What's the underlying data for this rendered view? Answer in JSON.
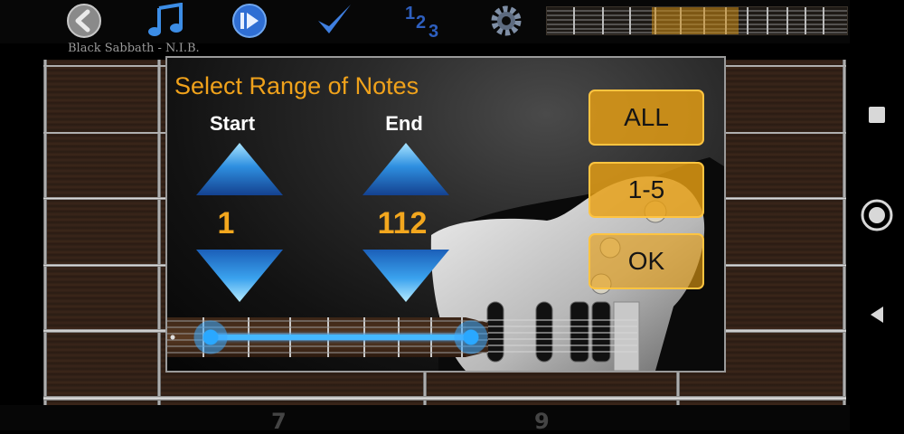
{
  "song": {
    "title": "Black Sabbath - N.I.B."
  },
  "toolbar": {
    "icons": [
      "back-arrow-icon",
      "music-note-icon",
      "play-icon",
      "checkmark-icon",
      "numbers-123-icon",
      "gear-icon"
    ]
  },
  "fretboard": {
    "visible_fret_numbers": [
      "7",
      "9"
    ]
  },
  "dialog": {
    "title": "Select Range of Notes",
    "start": {
      "label": "Start",
      "value": "1"
    },
    "end": {
      "label": "End",
      "value": "112"
    },
    "buttons": {
      "all": "ALL",
      "one_to_five": "1-5",
      "ok": "OK"
    },
    "range_selection": {
      "start_fraction": 0.0,
      "end_fraction": 1.0
    }
  },
  "colors": {
    "accent_orange": "#f0a21b",
    "arrow_blue": "#2e8fe0",
    "slider_blue": "#45b8ff"
  }
}
